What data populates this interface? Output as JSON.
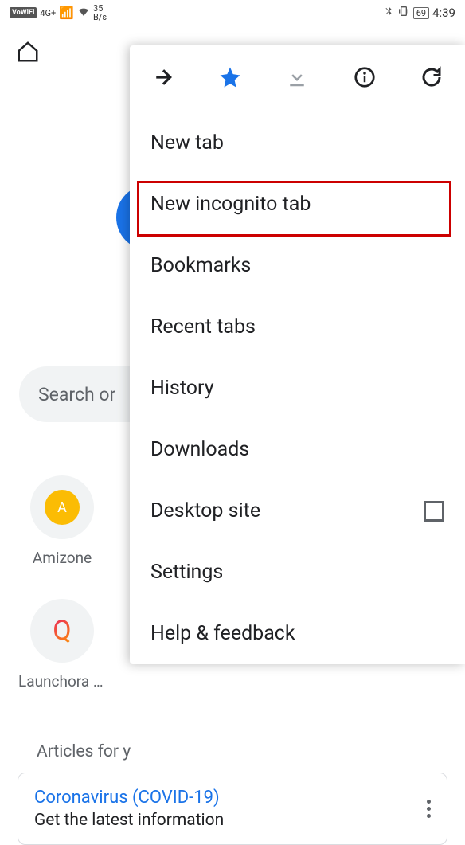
{
  "status": {
    "vowifi": "VoWiFi",
    "network": "4G+",
    "speed_top": "35",
    "speed_bottom": "B/s",
    "battery": "69",
    "time": "4:39"
  },
  "search_placeholder": "Search or",
  "tiles": [
    {
      "letter": "A",
      "label": "Amizone"
    },
    {
      "letter": "Q",
      "label": "Launchora -…"
    }
  ],
  "articles_heading": "Articles for y",
  "card": {
    "title": "Coronavirus (COVID-19)",
    "subtitle": "Get the latest information"
  },
  "menu": {
    "items": [
      "New tab",
      "New incognito tab",
      "Bookmarks",
      "Recent tabs",
      "History",
      "Downloads",
      "Desktop site",
      "Settings",
      "Help & feedback"
    ]
  }
}
